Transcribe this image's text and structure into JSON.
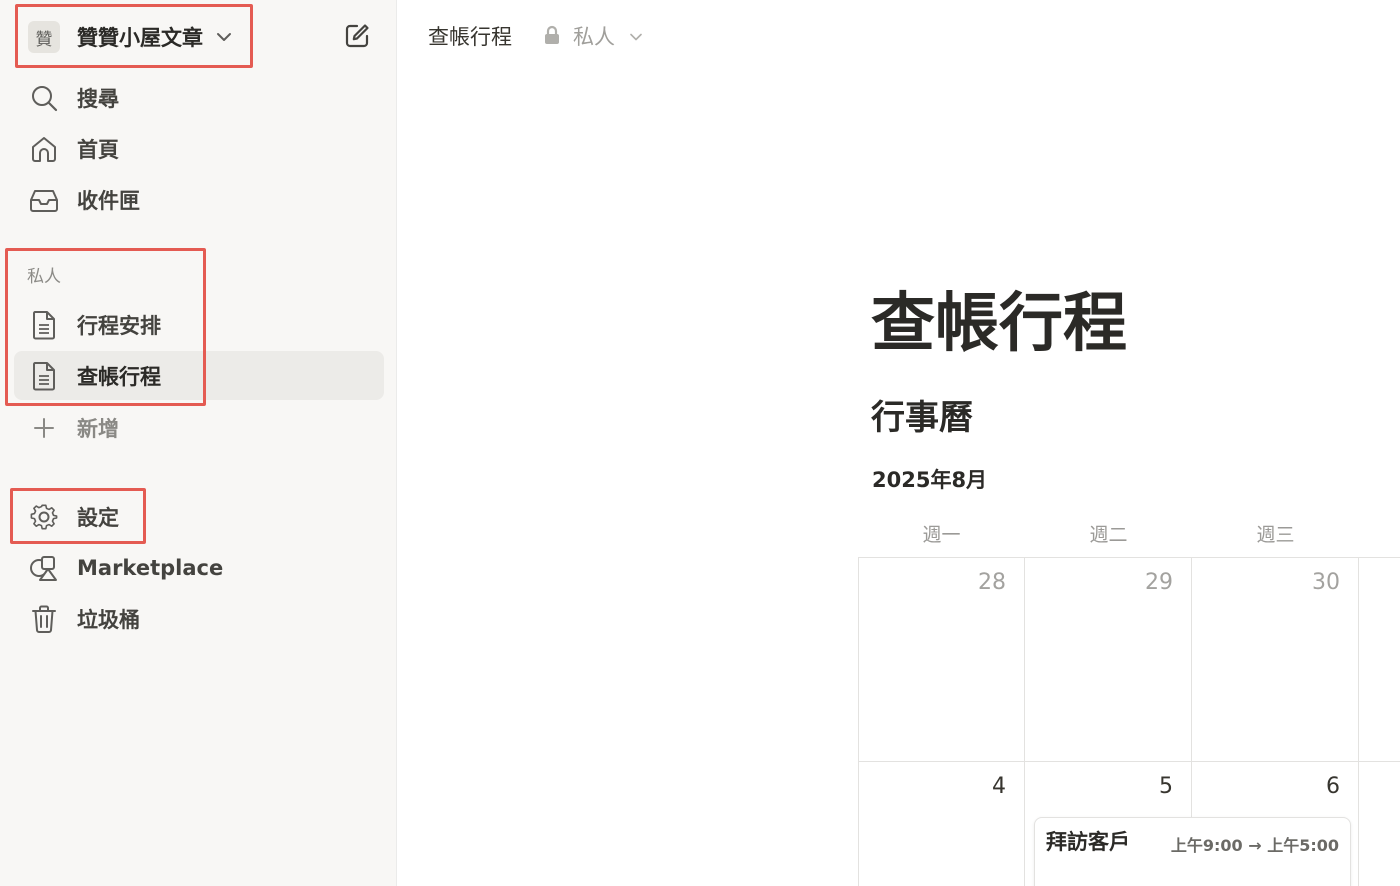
{
  "sidebar": {
    "workspace": {
      "avatar_text": "贊",
      "name": "贊贊小屋文章",
      "chevron_icon": "chevron-down-icon",
      "compose_icon": "new-page-icon"
    },
    "top_items": [
      {
        "label": "搜尋",
        "icon": "search-icon"
      },
      {
        "label": "首頁",
        "icon": "home-icon"
      },
      {
        "label": "收件匣",
        "icon": "inbox-icon"
      }
    ],
    "private_section": {
      "label": "私人",
      "pages": [
        {
          "label": "行程安排",
          "icon": "page-icon"
        },
        {
          "label": "查帳行程",
          "icon": "page-icon",
          "active": true
        }
      ],
      "add_label": "新增"
    },
    "bottom_items": [
      {
        "label": "設定",
        "icon": "gear-icon"
      },
      {
        "label": "Marketplace",
        "icon": "marketplace-icon"
      },
      {
        "label": "垃圾桶",
        "icon": "trash-icon"
      }
    ]
  },
  "topbar": {
    "breadcrumb": "查帳行程",
    "privacy": "私人",
    "lock_icon": "lock-icon"
  },
  "page": {
    "title": "查帳行程",
    "heading": "行事曆",
    "calendar": {
      "month": "2025年8月",
      "weekdays": [
        "週一",
        "週二",
        "週三"
      ],
      "weeks": [
        [
          {
            "day": "28"
          },
          {
            "day": "29"
          },
          {
            "day": "30"
          }
        ],
        [
          {
            "day": "4"
          },
          {
            "day": "5",
            "events": [
              {
                "title": "拜訪客戶",
                "time": "上午9:00 → 上午5:00"
              }
            ]
          },
          {
            "day": "6"
          }
        ]
      ]
    }
  },
  "colors": {
    "sidebar_bg": "#f8f7f5",
    "active_item_bg": "#ecebe8",
    "highlight": "#e45b52",
    "text": "#37352f",
    "muted": "#9b9a97"
  }
}
